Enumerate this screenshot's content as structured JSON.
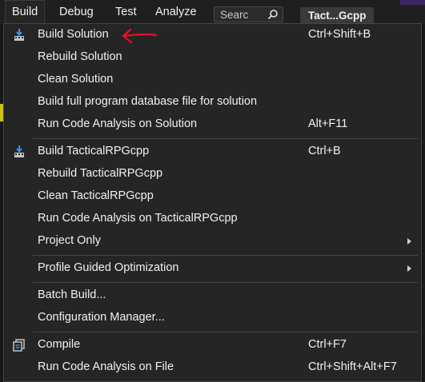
{
  "menubar": {
    "items": [
      "Build",
      "Debug",
      "Test",
      "Analyze"
    ],
    "search_placeholder": "Searc",
    "tab_label": "Tact...Gcpp"
  },
  "menu": {
    "groups": [
      [
        {
          "label": "Build Solution",
          "shortcut": "Ctrl+Shift+B",
          "icon": "build-icon"
        },
        {
          "label": "Rebuild Solution",
          "shortcut": ""
        },
        {
          "label": "Clean Solution",
          "shortcut": ""
        },
        {
          "label": "Build full program database file for solution",
          "shortcut": ""
        },
        {
          "label": "Run Code Analysis on Solution",
          "shortcut": "Alt+F11"
        }
      ],
      [
        {
          "label": "Build TacticalRPGcpp",
          "shortcut": "Ctrl+B",
          "icon": "build-icon"
        },
        {
          "label": "Rebuild TacticalRPGcpp",
          "shortcut": ""
        },
        {
          "label": "Clean TacticalRPGcpp",
          "shortcut": ""
        },
        {
          "label": "Run Code Analysis on TacticalRPGcpp",
          "shortcut": ""
        },
        {
          "label": "Project Only",
          "shortcut": "",
          "submenu": true
        }
      ],
      [
        {
          "label": "Profile Guided Optimization",
          "shortcut": "",
          "submenu": true
        }
      ],
      [
        {
          "label": "Batch Build...",
          "shortcut": ""
        },
        {
          "label": "Configuration Manager...",
          "shortcut": ""
        }
      ],
      [
        {
          "label": "Compile",
          "shortcut": "Ctrl+F7",
          "icon": "compile-icon"
        },
        {
          "label": "Run Code Analysis on File",
          "shortcut": "Ctrl+Shift+Alt+F7"
        }
      ]
    ]
  },
  "colors": {
    "menu_bg": "#252526",
    "menubar_bg": "#1f1f1f",
    "text": "#f1f1f1",
    "annotation": "#e81123"
  }
}
